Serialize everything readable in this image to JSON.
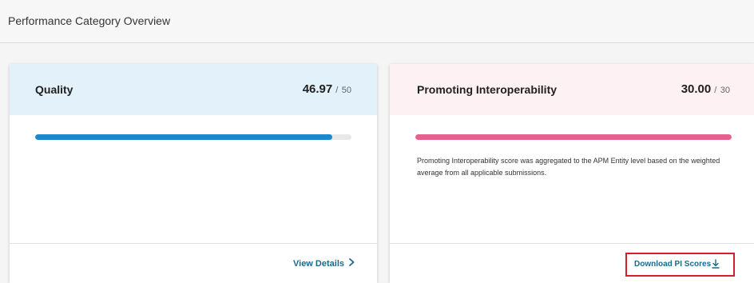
{
  "section": {
    "title": "Performance Category Overview"
  },
  "quality": {
    "name": "Quality",
    "score": "46.97",
    "separator": "/",
    "max": "50",
    "progress_fraction": 0.9394,
    "bar_color": "#1a88d0",
    "link_label": "View Details",
    "link_icon": "chevron-right-icon"
  },
  "pi": {
    "name": "Promoting Interoperability",
    "score": "30.00",
    "separator": "/",
    "max": "30",
    "progress_fraction": 1.0,
    "bar_color": "#e8608f",
    "note": "Promoting Interoperability score was aggregated to the APM Entity level based on the weighted average from all applicable submissions.",
    "download_label": "Download PI Scores",
    "download_icon": "download-icon",
    "highlight_color": "#d21f2b"
  }
}
